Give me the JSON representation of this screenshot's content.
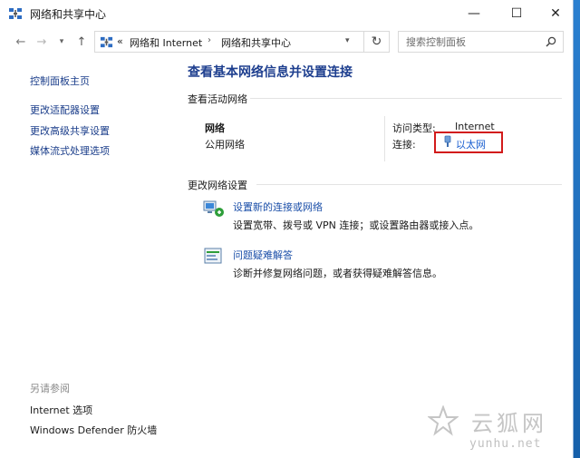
{
  "window": {
    "title": "网络和共享中心",
    "controls": {
      "minimize": "—",
      "maximize": "☐",
      "close": "✕"
    }
  },
  "address_bar": {
    "overflow": "«",
    "breadcrumbs": [
      "网络和 Internet",
      "网络和共享中心"
    ],
    "separator": "›"
  },
  "search": {
    "placeholder": "搜索控制面板"
  },
  "left_pane": {
    "links": [
      "控制面板主页",
      "更改适配器设置",
      "更改高级共享设置",
      "媒体流式处理选项"
    ],
    "see_also_label": "另请参阅",
    "see_also_links": [
      "Internet 选项",
      "Windows Defender 防火墙"
    ]
  },
  "main": {
    "title": "查看基本网络信息并设置连接",
    "active_networks_label": "查看活动网络",
    "network": {
      "name": "网络",
      "type": "公用网络",
      "access_type_label": "访问类型:",
      "access_type_value": "Internet",
      "connections_label": "连接:",
      "connection_name": "以太网"
    },
    "change_settings_label": "更改网络设置",
    "tasks": [
      {
        "icon": "network-setup-icon",
        "title": "设置新的连接或网络",
        "desc": "设置宽带、拨号或 VPN 连接；或设置路由器或接入点。"
      },
      {
        "icon": "troubleshoot-icon",
        "title": "问题疑难解答",
        "desc": "诊断并修复网络问题，或者获得疑难解答信息。"
      }
    ]
  },
  "watermark": {
    "cn": "云狐网",
    "en": "yunhu.net"
  },
  "colors": {
    "link": "#1a4ea8",
    "heading": "#1e3f8f",
    "highlight_box": "#d21a1a"
  }
}
